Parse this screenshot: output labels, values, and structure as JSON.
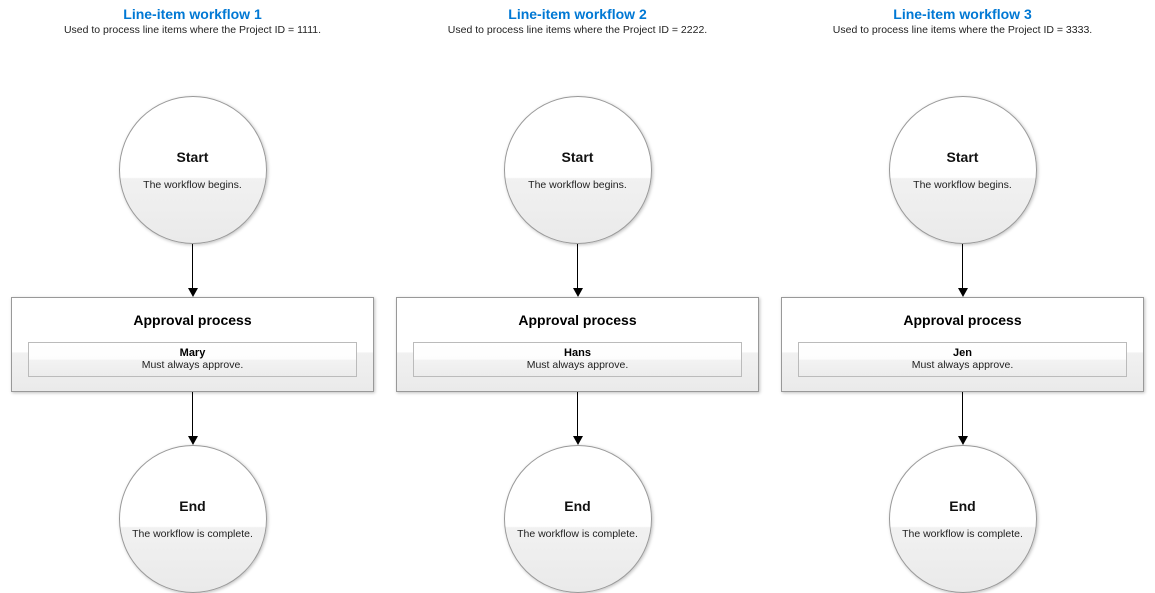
{
  "workflows": [
    {
      "title": "Line-item workflow 1",
      "subtitle": "Used to process line items where the Project ID = 1111.",
      "start_title": "Start",
      "start_sub": "The workflow begins.",
      "approval_title": "Approval process",
      "approver_name": "Mary",
      "approver_rule": "Must always approve.",
      "end_title": "End",
      "end_sub": "The workflow is complete."
    },
    {
      "title": "Line-item workflow 2",
      "subtitle": "Used to process line items where the Project ID = 2222.",
      "start_title": "Start",
      "start_sub": "The workflow begins.",
      "approval_title": "Approval process",
      "approver_name": "Hans",
      "approver_rule": "Must always approve.",
      "end_title": "End",
      "end_sub": "The workflow is complete."
    },
    {
      "title": "Line-item workflow 3",
      "subtitle": "Used to process line items where the Project ID = 3333.",
      "start_title": "Start",
      "start_sub": "The workflow begins.",
      "approval_title": "Approval process",
      "approver_name": "Jen",
      "approver_rule": "Must always approve.",
      "end_title": "End",
      "end_sub": "The workflow is complete."
    }
  ]
}
